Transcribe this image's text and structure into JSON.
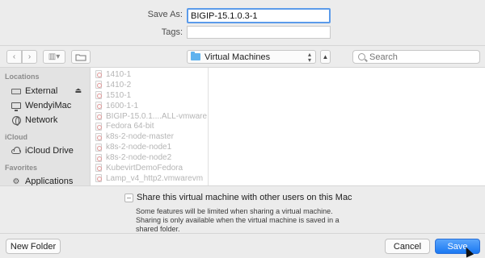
{
  "form": {
    "save_as_label": "Save As:",
    "save_as_value": "BIGIP-15.1.0.3-1",
    "tags_label": "Tags:",
    "tags_value": ""
  },
  "toolbar": {
    "back_glyph": "‹",
    "forward_glyph": "›",
    "view_glyph": "▥▾",
    "location": "Virtual Machines",
    "search_placeholder": "Search"
  },
  "sidebar": {
    "sections": [
      {
        "header": "Locations",
        "items": [
          "External",
          "WendyiMac",
          "Network"
        ]
      },
      {
        "header": "iCloud",
        "items": [
          "iCloud Drive"
        ]
      },
      {
        "header": "Favorites",
        "items": [
          "Applications"
        ]
      }
    ]
  },
  "files": [
    "1410-1",
    "1410-2",
    "1510-1",
    "1600-1-1",
    "BIGIP-15.0.1....ALL-vmware",
    "Fedora 64-bit",
    "k8s-2-node-master",
    "k8s-2-node-node1",
    "k8s-2-node-node2",
    "KubevirtDemoFedora",
    "Lamp_v4_http2.vmwarevm"
  ],
  "share": {
    "checkbox_label": "Share this virtual machine with other users on this Mac",
    "checked": true,
    "note": "Some features will be limited when sharing a virtual machine. Sharing is only available when the virtual machine is saved in a shared folder."
  },
  "buttons": {
    "new_folder": "New Folder",
    "cancel": "Cancel",
    "save": "Save"
  },
  "colors": {
    "accent": "#1a78f2",
    "focus_ring": "#5b9bea",
    "folder": "#5fb2ee"
  }
}
